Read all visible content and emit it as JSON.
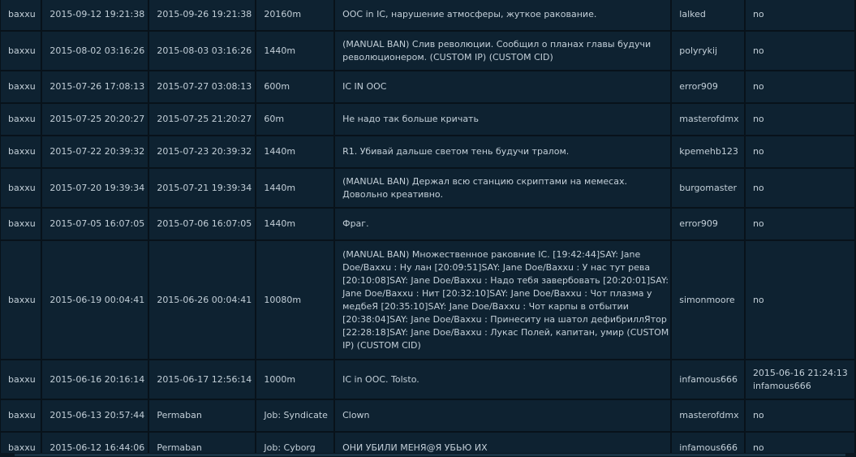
{
  "bans": [
    {
      "ckey": "baxxu",
      "bantime": "2015-09-12 19:21:38",
      "expires": "2015-09-26 19:21:38",
      "duration": "20160m",
      "reason": "OOC in IC, нарушение атмосферы, жуткое ракование.",
      "admin": "lalked",
      "unbanned": "no"
    },
    {
      "ckey": "baxxu",
      "bantime": "2015-08-02 03:16:26",
      "expires": "2015-08-03 03:16:26",
      "duration": "1440m",
      "reason": "(MANUAL BAN) Слив революции. Сообщил о планах главы будучи революционером. (CUSTOM IP) (CUSTOM CID)",
      "admin": "polyrykij",
      "unbanned": "no"
    },
    {
      "ckey": "baxxu",
      "bantime": "2015-07-26 17:08:13",
      "expires": "2015-07-27 03:08:13",
      "duration": "600m",
      "reason": "IC IN OOC",
      "admin": "error909",
      "unbanned": "no"
    },
    {
      "ckey": "baxxu",
      "bantime": "2015-07-25 20:20:27",
      "expires": "2015-07-25 21:20:27",
      "duration": "60m",
      "reason": "Не надо так больше кричать",
      "admin": "masterofdmx",
      "unbanned": "no"
    },
    {
      "ckey": "baxxu",
      "bantime": "2015-07-22 20:39:32",
      "expires": "2015-07-23 20:39:32",
      "duration": "1440m",
      "reason": "R1. Убивай дальше светом тень будучи тралом.",
      "admin": "kpemehb123",
      "unbanned": "no"
    },
    {
      "ckey": "baxxu",
      "bantime": "2015-07-20 19:39:34",
      "expires": "2015-07-21 19:39:34",
      "duration": "1440m",
      "reason": "(MANUAL BAN) Держал всю станцию скриптами на мемесах. Довольно креативно.",
      "admin": "burgomaster",
      "unbanned": "no"
    },
    {
      "ckey": "baxxu",
      "bantime": "2015-07-05 16:07:05",
      "expires": "2015-07-06 16:07:05",
      "duration": "1440m",
      "reason": "Фраг.",
      "admin": "error909",
      "unbanned": "no"
    },
    {
      "ckey": "baxxu",
      "bantime": "2015-06-19 00:04:41",
      "expires": "2015-06-26 00:04:41",
      "duration": "10080m",
      "reason": "(MANUAL BAN) Множественное раковние IC. [19:42:44]SAY: Jane Doe/Baxxu : Ну лан [20:09:51]SAY: Jane Doe/Baxxu : У нас тут рева [20:10:08]SAY: Jane Doe/Baxxu : Надо тебя завербовать [20:20:01]SAY: Jane Doe/Baxxu : Нит [20:32:10]SAY: Jane Doe/Baxxu : Чот плазма у медбеЯ [20:35:10]SAY: Jane Doe/Baxxu : Чот карпы в отбытии [20:38:04]SAY: Jane Doe/Baxxu : Принеситу на шатол дефибриллЯтор [22:28:18]SAY: Jane Doe/Baxxu : Лукас Полей, капитан, умир (CUSTOM IP) (CUSTOM CID)",
      "admin": "simonmoore",
      "unbanned": "no"
    },
    {
      "ckey": "baxxu",
      "bantime": "2015-06-16 20:16:14",
      "expires": "2015-06-17 12:56:14",
      "duration": "1000m",
      "reason": "IC in OOC. Tolsto.",
      "admin": "infamous666",
      "unbanned": "2015-06-16 21:24:13 infamous666"
    },
    {
      "ckey": "baxxu",
      "bantime": "2015-06-13 20:57:44",
      "expires": "Permaban",
      "duration": "Job: Syndicate",
      "reason": "Clown",
      "admin": "masterofdmx",
      "unbanned": "no"
    },
    {
      "ckey": "baxxu",
      "bantime": "2015-06-12 16:44:06",
      "expires": "Permaban",
      "duration": "Job: Cyborg",
      "reason": "ОНИ УБИЛИ МЕНЯ@Я УБЬЮ ИХ",
      "admin": "infamous666",
      "unbanned": "no"
    }
  ]
}
